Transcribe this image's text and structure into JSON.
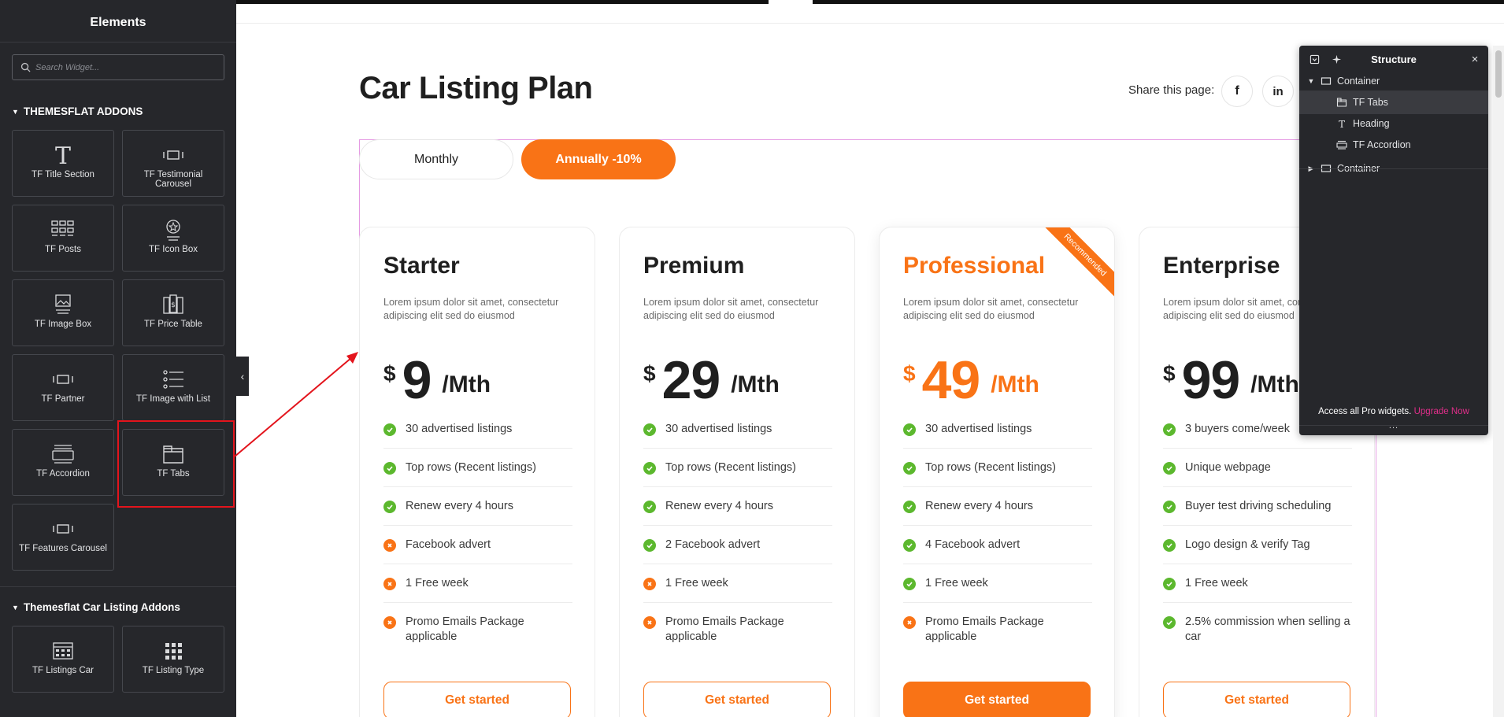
{
  "left_panel": {
    "title": "Elements",
    "search_placeholder": "Search Widget...",
    "section1_title": "THEMESFLAT ADDONS",
    "widgets1": [
      {
        "label": "TF Title Section",
        "icon": "title-section-icon"
      },
      {
        "label": "TF Testimonial Carousel",
        "icon": "testimonial-carousel-icon"
      },
      {
        "label": "TF Posts",
        "icon": "posts-grid-icon"
      },
      {
        "label": "TF Icon Box",
        "icon": "icon-box-icon"
      },
      {
        "label": "TF Image Box",
        "icon": "image-box-icon"
      },
      {
        "label": "TF Price Table",
        "icon": "price-table-icon"
      },
      {
        "label": "TF Partner",
        "icon": "partner-icon"
      },
      {
        "label": "TF Image with List",
        "icon": "image-with-list-icon"
      },
      {
        "label": "TF Accordion",
        "icon": "accordion-icon"
      },
      {
        "label": "TF Tabs",
        "icon": "tabs-icon"
      },
      {
        "label": "TF Features Carousel",
        "icon": "features-carousel-icon"
      }
    ],
    "section2_title": "Themesflat Car Listing Addons",
    "widgets2": [
      {
        "label": "TF Listings Car",
        "icon": "listings-car-icon"
      },
      {
        "label": "TF Listing Type",
        "icon": "listing-type-icon"
      }
    ]
  },
  "page": {
    "title": "Car Listing Plan",
    "share_label": "Share this page:",
    "social": [
      "f",
      "in"
    ],
    "tabs": [
      {
        "label": "Monthly",
        "active": false
      },
      {
        "label": "Annually -10%",
        "active": true
      }
    ],
    "accent_color": "#f97316",
    "plans": [
      {
        "name": "Starter",
        "description": "Lorem ipsum dolor sit amet, consectetur adipiscing elit sed do eiusmod",
        "currency": "$",
        "price": "9",
        "period": "/Mth",
        "featured": false,
        "features": [
          {
            "text": "30 advertised listings",
            "included": true
          },
          {
            "text": "Top rows (Recent listings)",
            "included": true
          },
          {
            "text": "Renew every 4 hours",
            "included": true
          },
          {
            "text": "Facebook advert",
            "included": false
          },
          {
            "text": "1 Free week",
            "included": false
          },
          {
            "text": "Promo Emails Package applicable",
            "included": false
          }
        ],
        "cta": "Get started"
      },
      {
        "name": "Premium",
        "description": "Lorem ipsum dolor sit amet, consectetur adipiscing elit sed do eiusmod",
        "currency": "$",
        "price": "29",
        "period": "/Mth",
        "featured": false,
        "features": [
          {
            "text": "30 advertised listings",
            "included": true
          },
          {
            "text": "Top rows (Recent listings)",
            "included": true
          },
          {
            "text": "Renew every 4 hours",
            "included": true
          },
          {
            "text": "2 Facebook advert",
            "included": true
          },
          {
            "text": "1 Free week",
            "included": false
          },
          {
            "text": "Promo Emails Package applicable",
            "included": false
          }
        ],
        "cta": "Get started"
      },
      {
        "name": "Professional",
        "description": "Lorem ipsum dolor sit amet, consectetur adipiscing elit sed do eiusmod",
        "currency": "$",
        "price": "49",
        "period": "/Mth",
        "featured": true,
        "ribbon": "Recommended",
        "features": [
          {
            "text": "30 advertised listings",
            "included": true
          },
          {
            "text": "Top rows (Recent listings)",
            "included": true
          },
          {
            "text": "Renew every 4 hours",
            "included": true
          },
          {
            "text": "4 Facebook advert",
            "included": true
          },
          {
            "text": "1 Free week",
            "included": true
          },
          {
            "text": "Promo Emails Package applicable",
            "included": false
          }
        ],
        "cta": "Get started"
      },
      {
        "name": "Enterprise",
        "description": "Lorem ipsum dolor sit amet, consectetur adipiscing elit sed do eiusmod",
        "currency": "$",
        "price": "99",
        "period": "/Mth",
        "featured": false,
        "features": [
          {
            "text": "3 buyers come/week",
            "included": true
          },
          {
            "text": "Unique webpage",
            "included": true
          },
          {
            "text": "Buyer test driving scheduling",
            "included": true
          },
          {
            "text": "Logo design & verify Tag",
            "included": true
          },
          {
            "text": "1 Free week",
            "included": true
          },
          {
            "text": "2.5% commission when selling a car",
            "included": true
          }
        ],
        "cta": "Get started"
      }
    ]
  },
  "structure": {
    "title": "Structure",
    "tree": [
      {
        "label": "Container",
        "level": 0,
        "caret": "down",
        "icon": "container-icon",
        "active": false
      },
      {
        "label": "TF Tabs",
        "level": 1,
        "caret": "",
        "icon": "tabs-icon",
        "active": true
      },
      {
        "label": "Heading",
        "level": 1,
        "caret": "",
        "icon": "heading-icon",
        "active": false
      },
      {
        "label": "TF Accordion",
        "level": 1,
        "caret": "",
        "icon": "accordion-icon",
        "active": false
      },
      {
        "label": "Container",
        "level": 0,
        "caret": "right",
        "icon": "container-icon",
        "active": false
      }
    ],
    "pro_text": "Access all Pro widgets.",
    "upgrade_text": "Upgrade Now",
    "dots": "..."
  }
}
